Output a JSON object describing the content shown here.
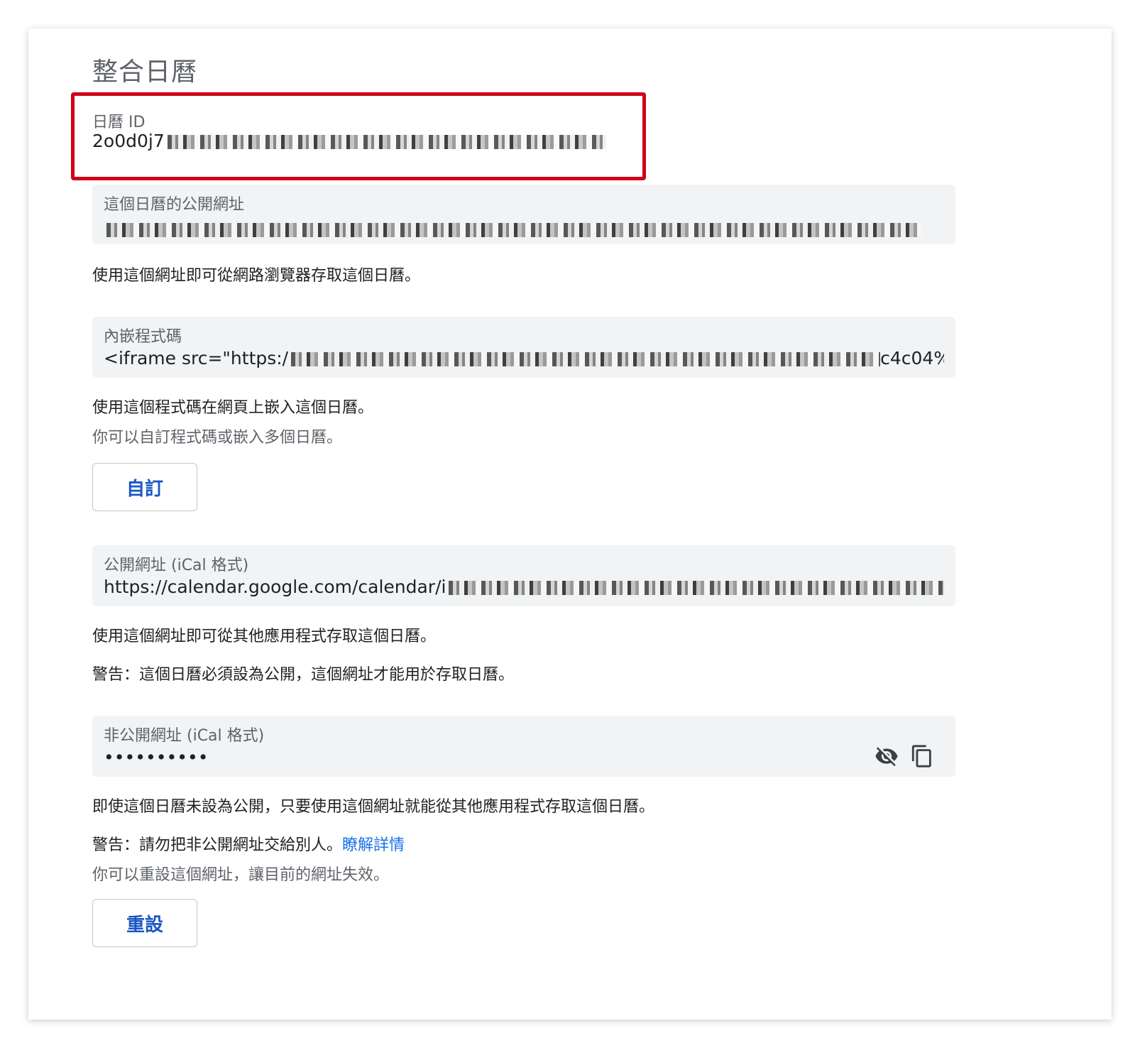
{
  "title": "整合日曆",
  "calendar_id": {
    "label": "日曆 ID",
    "value": "2o0d0j7"
  },
  "public_url": {
    "label": "這個日曆的公開網址",
    "description": "使用這個網址即可從網路瀏覽器存取這個日曆。"
  },
  "embed_code": {
    "label": "內嵌程式碼",
    "value_prefix": "<iframe src=\"https:/",
    "value_suffix": "c4c04%",
    "description": "使用這個程式碼在網頁上嵌入這個日曆。",
    "note": "你可以自訂程式碼或嵌入多個日曆。",
    "button_label": "自訂"
  },
  "ical_public": {
    "label": "公開網址 (iCal 格式)",
    "value_prefix": "https://calendar.google.com/calendar/i",
    "description": "使用這個網址即可從其他應用程式存取這個日曆。",
    "warning": "警告：這個日曆必須設為公開，這個網址才能用於存取日曆。"
  },
  "ical_private": {
    "label": "非公開網址 (iCal 格式)",
    "value": "••••••••••",
    "icons": [
      "visibility-off-icon",
      "copy-icon"
    ],
    "description": "即使這個日曆未設為公開，只要使用這個網址就能從其他應用程式存取這個日曆。",
    "warning": "警告：請勿把非公開網址交給別人。",
    "learn_more": "瞭解詳情",
    "note": "你可以重設這個網址，讓目前的網址失效。",
    "button_label": "重設"
  },
  "colors": {
    "highlight_border": "#d0021b",
    "field_background": "#f1f3f4",
    "link": "#1a73e8",
    "button_text": "#1a56c4"
  }
}
